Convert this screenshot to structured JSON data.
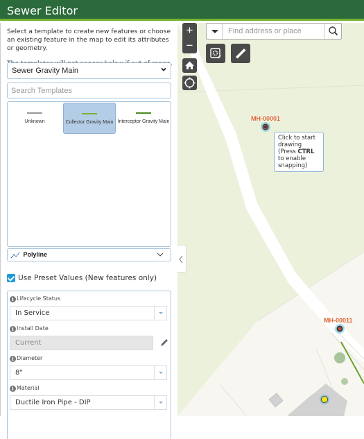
{
  "header": {
    "title": "Sewer Editor"
  },
  "panel": {
    "intro": "Select a template to create new features or choose an existing feature in the map to edit its attributes or geometry.",
    "range_note": "The templates will not appear below if out of range.",
    "layer_select": {
      "value": "Sewer Gravity Main"
    },
    "search_templates": {
      "placeholder": "Search Templates"
    },
    "templates": [
      {
        "label": "Unknown",
        "color": "#999999",
        "selected": false
      },
      {
        "label": "Collector Gravity Main",
        "color": "#77b235",
        "selected": true
      },
      {
        "label": "Interceptor Gravity Main",
        "color": "#4e8a1e",
        "selected": false
      }
    ],
    "geometry_select": {
      "value": "Polyline"
    },
    "preset": {
      "label": "Use Preset Values (New features only)",
      "checked": true
    },
    "fields": [
      {
        "label": "Lifecycle Status",
        "value": "In Service",
        "type": "dropdown"
      },
      {
        "label": "Install Date",
        "value": "Current",
        "type": "readonly-edit"
      },
      {
        "label": "Diameter",
        "value": "8\"",
        "type": "dropdown"
      },
      {
        "label": "Material",
        "value": "Ductile Iron Pipe - DIP",
        "type": "dropdown"
      }
    ]
  },
  "map": {
    "search": {
      "placeholder": "Find address or place"
    },
    "controls": {
      "zoom_in": "+",
      "zoom_out": "−"
    },
    "manholes": [
      {
        "id": "MH-00001"
      },
      {
        "id": "MH-00011"
      }
    ],
    "tooltip": {
      "line1": "Click to start drawing (Press ",
      "key": "CTRL",
      "line2": " to enable snapping)"
    },
    "colors": {
      "label": "#d9622b",
      "sewer_line": "#77b235",
      "basemap_green": "#ecf1dc"
    }
  }
}
